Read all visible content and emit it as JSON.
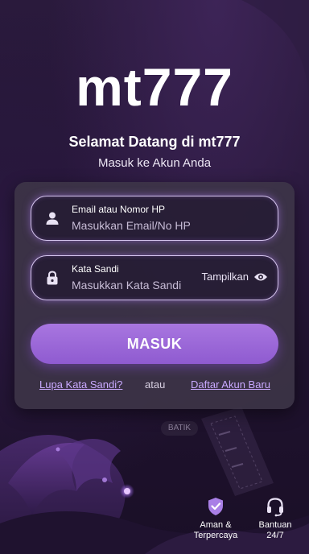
{
  "app": {
    "logo": "mt777",
    "welcome_title": "Selamat Datang di mt777",
    "welcome_subtitle": "Masuk ke Akun Anda"
  },
  "form": {
    "email": {
      "label": "Email atau Nomor HP",
      "placeholder": "Masukkan Email/No HP",
      "value": "",
      "icon": "user-icon"
    },
    "password": {
      "label": "Kata Sandi",
      "placeholder": "Masukkan Kata Sandi",
      "value": "",
      "icon": "lock-icon",
      "toggle_label": "Tampilkan",
      "toggle_icon": "eye-icon"
    },
    "submit_label": "MASUK"
  },
  "links": {
    "forgot": "Lupa Kata Sandi?",
    "separator": "atau",
    "register": "Daftar Akun Baru"
  },
  "decor": {
    "batik_label": "BATIK"
  },
  "features": [
    {
      "label_line1": "Aman &",
      "label_line2": "Terpercaya",
      "icon": "shield-check-icon"
    },
    {
      "label_line1": "Bantuan",
      "label_line2": "24/7",
      "icon": "headset-icon"
    }
  ],
  "colors": {
    "accent": "#9a66d8",
    "link": "#c9a9ff",
    "background": "#221432",
    "card": "#3e3648"
  }
}
